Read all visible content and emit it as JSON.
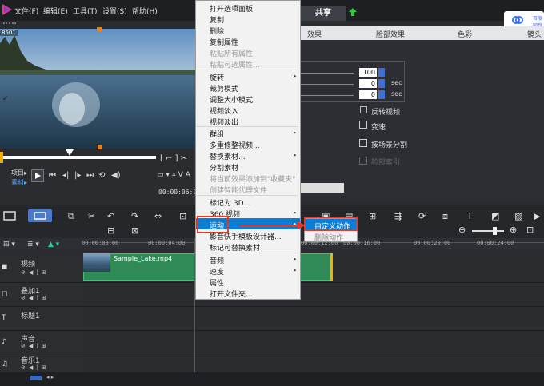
{
  "menubar": {
    "items": [
      "文件(F)",
      "编辑(E)",
      "工具(T)",
      "设置(S)",
      "帮助(H)"
    ],
    "share_tab": "共享",
    "topright_text": "百度网盘"
  },
  "preview": {
    "label": "8501",
    "clip_labels": {
      "project": "项目▸",
      "clip": "素材▸"
    },
    "timecode": "00:00:06:02"
  },
  "options": {
    "tabs": [
      "效果",
      "脸部效果",
      "色彩",
      "镜头"
    ],
    "value1": "100",
    "value2": "0",
    "value3": "0",
    "unit": "sec",
    "reverse_video": "反转视频",
    "speed": "变速",
    "scene_split": "按场景分割",
    "face_index": "脸部索引"
  },
  "timeline": {
    "ruler": [
      "00:00:00:00",
      "00:00:04:00",
      "00:00:12:00",
      "00:00:16:00",
      "00:00:20:00",
      "00:00:24:00"
    ],
    "tracks": [
      {
        "name": "视频",
        "icon": "video-icon"
      },
      {
        "name": "叠加1",
        "icon": "overlay-icon"
      },
      {
        "name": "标题1",
        "icon": "title-icon"
      },
      {
        "name": "声音",
        "icon": "voice-icon"
      },
      {
        "name": "音乐1",
        "icon": "music-icon"
      }
    ],
    "clip_name": "Sample_Lake.mp4"
  },
  "context_menu": {
    "items": [
      {
        "label": "打开选项面板",
        "disabled": false
      },
      {
        "label": "复制",
        "disabled": false
      },
      {
        "label": "删除",
        "disabled": false
      },
      {
        "label": "复制属性",
        "disabled": false
      },
      {
        "label": "粘贴所有属性",
        "disabled": true
      },
      {
        "label": "粘贴可选属性...",
        "disabled": true
      },
      {
        "label": "旋转",
        "disabled": false,
        "submenu": true
      },
      {
        "label": "裁剪模式",
        "disabled": false
      },
      {
        "label": "调整大小模式",
        "disabled": false,
        "checked": true
      },
      {
        "label": "视频淡入",
        "disabled": false
      },
      {
        "label": "视频淡出",
        "disabled": false
      },
      {
        "label": "群组",
        "disabled": false,
        "submenu": true
      },
      {
        "label": "多重修整视频...",
        "disabled": false
      },
      {
        "label": "替换素材...",
        "disabled": false,
        "submenu": true
      },
      {
        "label": "分割素材",
        "disabled": false
      },
      {
        "label": "将当前效果添加到\"收藏夹\"",
        "disabled": true
      },
      {
        "label": "创建智能代理文件",
        "disabled": true
      },
      {
        "label": "标记为 3D...",
        "disabled": false
      },
      {
        "label": "360 视频",
        "disabled": false,
        "submenu": true
      },
      {
        "label": "运动",
        "disabled": false,
        "submenu": true,
        "highlighted": true
      },
      {
        "label": "影音快手模板设计器...",
        "disabled": false
      },
      {
        "label": "标记可替换素材",
        "disabled": false
      },
      {
        "label": "音频",
        "disabled": false,
        "submenu": true
      },
      {
        "label": "速度",
        "disabled": false,
        "submenu": true
      },
      {
        "label": "属性...",
        "disabled": false
      },
      {
        "label": "打开文件夹...",
        "disabled": false
      }
    ]
  },
  "submenu": {
    "items": [
      {
        "label": "自定义动作",
        "highlighted": true
      },
      {
        "label": "删除动作",
        "disabled": true
      }
    ]
  },
  "colors": {
    "accent": "#0a7ed6",
    "highlight_border": "#e03c2e",
    "clip_green": "#2f8a57",
    "playhead": "#cc2a1f"
  }
}
